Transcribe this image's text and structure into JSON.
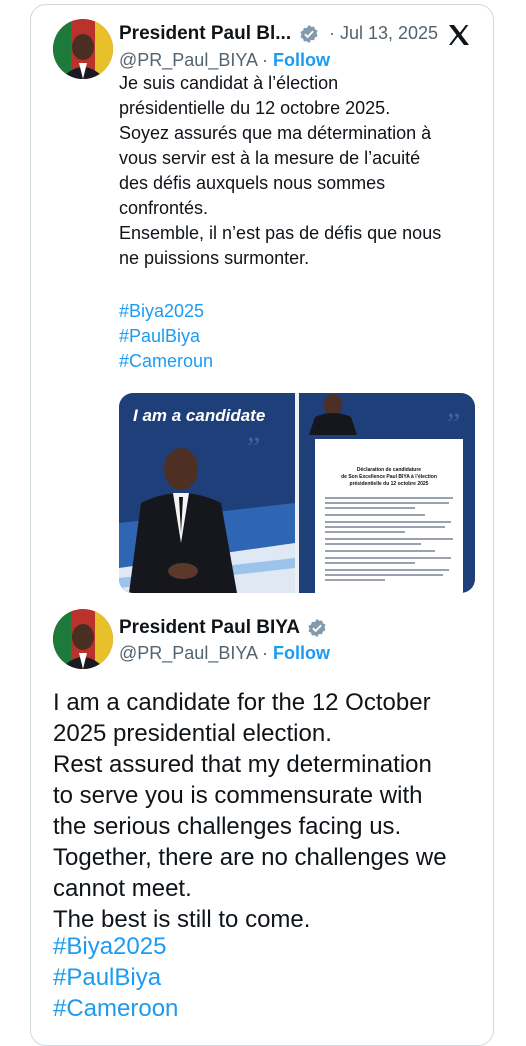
{
  "tweet1": {
    "author_name": "President Paul Bl...",
    "handle": "@PR_Paul_BIYA",
    "separator": "·",
    "follow_label": "Follow",
    "date": "· Jul 13, 2025",
    "text_lines": [
      "Je suis candidat à l’élection",
      "présidentielle du 12 octobre 2025.",
      "Soyez assurés que ma détermination à",
      "vous servir est à la mesure de l’acuité",
      "des défis auxquels nous sommes",
      "confrontés.",
      "Ensemble, il n’est pas de défis que nous",
      "ne puissions surmonter."
    ],
    "hashtags": [
      "#Biya2025",
      "#PaulBiya",
      "#Cameroun"
    ],
    "media": {
      "left_caption": "I am a candidate",
      "doc_title_lines": [
        "Déclaration de candidature",
        "de Son Excellence Paul BIYA à l’élection",
        "présidentielle du 12 octobre 2025"
      ]
    }
  },
  "tweet2": {
    "author_name": "President Paul BIYA",
    "handle": "@PR_Paul_BIYA",
    "separator": "·",
    "follow_label": "Follow",
    "text_lines": [
      "I am a candidate for the 12 October",
      "2025 presidential election.",
      "Rest assured that my determination",
      "to serve you is commensurate with",
      "the serious challenges facing us.",
      "Together, there are no challenges we",
      "cannot meet.",
      "The best is still to come."
    ],
    "hashtags": [
      "#Biya2025",
      "#PaulBiya",
      "#Cameroon"
    ]
  },
  "colors": {
    "accent": "#1d9bf0",
    "text": "#0f1419",
    "muted": "#536471",
    "media_blue": "#1e3f7a"
  }
}
